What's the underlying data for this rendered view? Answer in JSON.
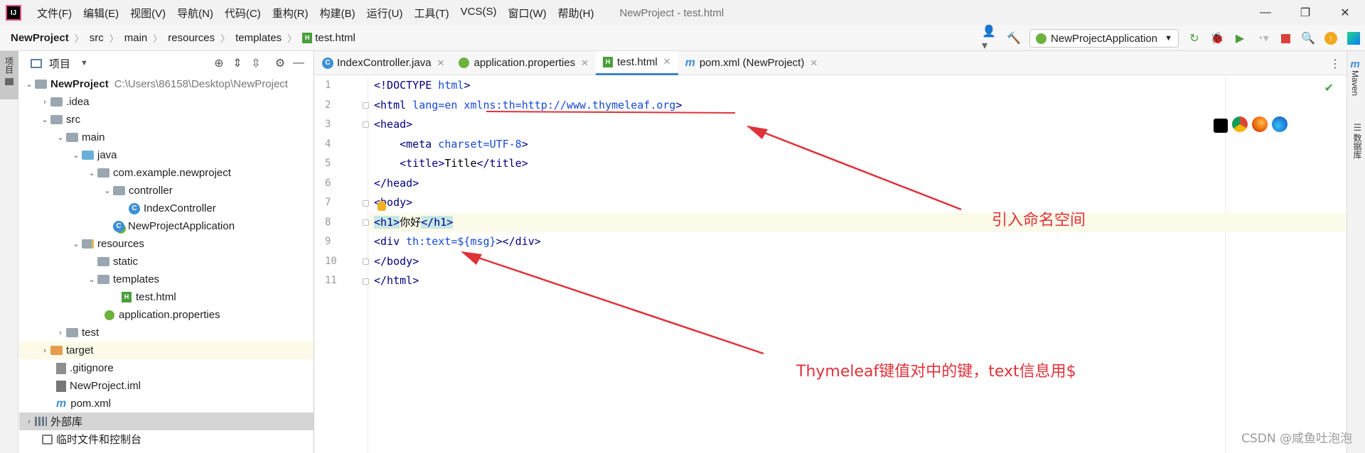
{
  "menubar": {
    "logo": "IJ",
    "items": [
      "文件(F)",
      "编辑(E)",
      "视图(V)",
      "导航(N)",
      "代码(C)",
      "重构(R)",
      "构建(B)",
      "运行(U)",
      "工具(T)",
      "VCS(S)",
      "窗口(W)",
      "帮助(H)"
    ],
    "window_title": "NewProject - test.html",
    "controls": {
      "minimize": "—",
      "restore": "❐",
      "close": "✕"
    }
  },
  "navbar": {
    "crumbs": [
      "NewProject",
      "src",
      "main",
      "resources",
      "templates",
      "test.html"
    ],
    "run_config": "NewProjectApplication"
  },
  "left_strip": {
    "project_tab": "项目"
  },
  "right_strip": {
    "maven": "Maven",
    "database": "数据库"
  },
  "project_panel": {
    "title": "项目",
    "tree": [
      {
        "label": "NewProject",
        "path": "C:\\Users\\86158\\Desktop\\NewProject",
        "icon": "folder",
        "depth": 0,
        "expanded": true,
        "bold": true
      },
      {
        "label": ".idea",
        "icon": "folder",
        "depth": 1,
        "collapsed": true
      },
      {
        "label": "src",
        "icon": "folder",
        "depth": 1,
        "expanded": true
      },
      {
        "label": "main",
        "icon": "folder",
        "depth": 2,
        "expanded": true
      },
      {
        "label": "java",
        "icon": "folder-blue",
        "depth": 3,
        "expanded": true
      },
      {
        "label": "com.example.newproject",
        "icon": "package",
        "depth": 4,
        "expanded": true
      },
      {
        "label": "controller",
        "icon": "package",
        "depth": 5,
        "expanded": true
      },
      {
        "label": "IndexController",
        "icon": "class",
        "depth": 6
      },
      {
        "label": "NewProjectApplication",
        "icon": "spring-class",
        "depth": 5
      },
      {
        "label": "resources",
        "icon": "resources-folder",
        "depth": 3,
        "expanded": true
      },
      {
        "label": "static",
        "icon": "folder",
        "depth": 4
      },
      {
        "label": "templates",
        "icon": "folder",
        "depth": 4,
        "expanded": true
      },
      {
        "label": "test.html",
        "icon": "html-file",
        "depth": 5
      },
      {
        "label": "application.properties",
        "icon": "properties-file",
        "depth": 4
      },
      {
        "label": "test",
        "icon": "folder",
        "depth": 2,
        "collapsed": true
      },
      {
        "label": "target",
        "icon": "folder-orange",
        "depth": 1,
        "collapsed": true,
        "highlight": true
      },
      {
        "label": ".gitignore",
        "icon": "git-file",
        "depth": 1
      },
      {
        "label": "NewProject.iml",
        "icon": "iml-file",
        "depth": 1
      },
      {
        "label": "pom.xml",
        "icon": "maven-file",
        "depth": 1
      },
      {
        "label": "外部库",
        "icon": "library",
        "depth": 0,
        "collapsed": true,
        "selected": true
      },
      {
        "label": "临时文件和控制台",
        "icon": "scratch",
        "depth": 0
      }
    ]
  },
  "editor": {
    "tabs": [
      {
        "label": "IndexController.java",
        "icon": "class",
        "active": false
      },
      {
        "label": "application.properties",
        "icon": "properties-file",
        "active": false
      },
      {
        "label": "test.html",
        "icon": "html-file",
        "active": true
      },
      {
        "label": "pom.xml (NewProject)",
        "icon": "maven-file",
        "active": false
      }
    ],
    "lines": [
      "<!DOCTYPE html>",
      "<html lang=\"en\" xmlns:th=\"http://www.thymeleaf.org\">",
      "<head>",
      "    <meta charset=\"UTF-8\">",
      "    <title>Title</title>",
      "</head>",
      "<body>",
      "<h1>你好</h1>",
      "<div th:text=\"${msg}\"></div>",
      "</body>",
      "</html>"
    ],
    "current_line": 8
  },
  "annotations": {
    "namespace": "引入命名空间",
    "key": "Thymeleaf键值对中的键，text信息用$",
    "color": "#e0323a"
  },
  "watermark": "CSDN @咸鱼吐泡泡"
}
